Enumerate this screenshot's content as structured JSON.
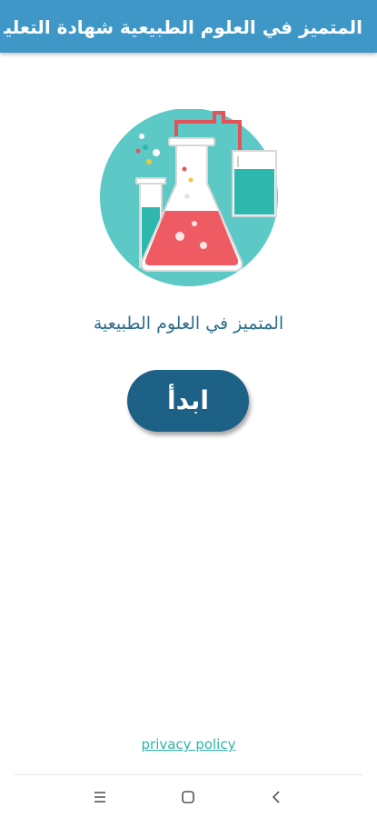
{
  "appbar": {
    "title": "المتميز في العلوم الطبيعية شهادة التعليم المتو...",
    "color": "#3f97c8"
  },
  "main": {
    "subtitle": "المتميز في العلوم الطبيعية",
    "start_button_label": "ابدأ",
    "button_color": "#1e6186",
    "illustration_icon": "chemistry-lab-glassware-illustration"
  },
  "footer": {
    "privacy_link": "privacy policy"
  },
  "system_nav": {
    "buttons": [
      "recent-apps-icon",
      "home-icon",
      "back-icon"
    ]
  }
}
